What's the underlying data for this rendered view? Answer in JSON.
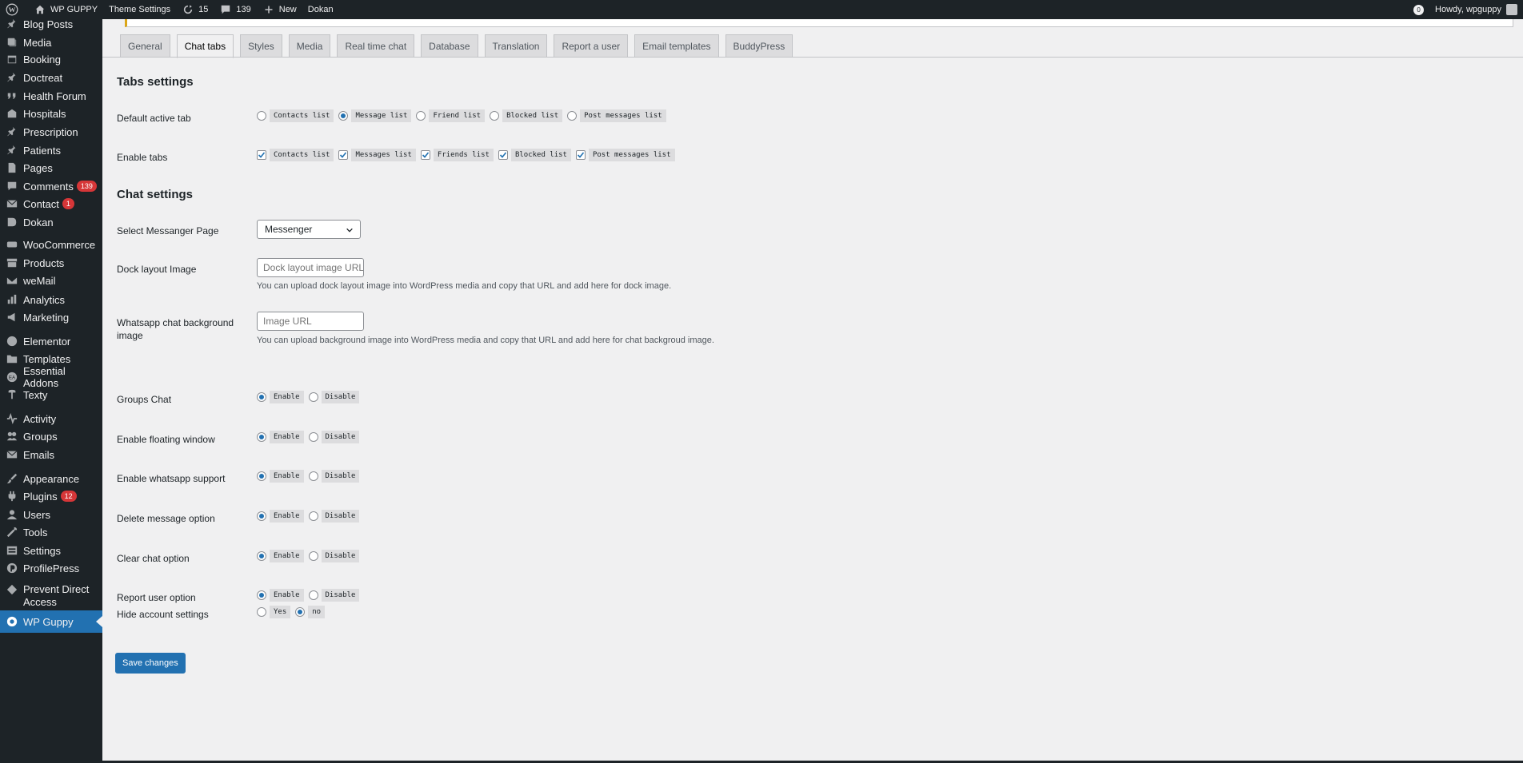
{
  "adminbar": {
    "site_name": "WP GUPPY",
    "theme_settings": "Theme Settings",
    "updates_count": "15",
    "comments_count": "139",
    "new_label": "New",
    "dokan_label": "Dokan",
    "howdy": "Howdy, wpguppy",
    "notif_count": "0"
  },
  "sidebar": {
    "items": [
      {
        "label": "Blog Posts",
        "icon": "pin-icon"
      },
      {
        "label": "Media",
        "icon": "media-icon"
      },
      {
        "label": "Booking",
        "icon": "calendar-icon"
      },
      {
        "label": "Doctreat",
        "icon": "pin-icon"
      },
      {
        "label": "Health Forum",
        "icon": "quote-icon"
      },
      {
        "label": "Hospitals",
        "icon": "building-icon"
      },
      {
        "label": "Prescription",
        "icon": "pin-icon"
      },
      {
        "label": "Patients",
        "icon": "pin-icon"
      },
      {
        "label": "Pages",
        "icon": "page-icon"
      },
      {
        "label": "Comments",
        "icon": "comment-icon",
        "badge": "139"
      },
      {
        "label": "Contact",
        "icon": "mail-icon",
        "badge": "1"
      },
      {
        "label": "Dokan",
        "icon": "dokan-icon"
      },
      {
        "label": "WooCommerce",
        "icon": "woo-icon"
      },
      {
        "label": "Products",
        "icon": "archive-icon"
      },
      {
        "label": "weMail",
        "icon": "wemail-icon"
      },
      {
        "label": "Analytics",
        "icon": "bar-chart-icon"
      },
      {
        "label": "Marketing",
        "icon": "megaphone-icon"
      },
      {
        "label": "Elementor",
        "icon": "elementor-icon"
      },
      {
        "label": "Templates",
        "icon": "folder-icon"
      },
      {
        "label": "Essential Addons",
        "icon": "ea-icon"
      },
      {
        "label": "Texty",
        "icon": "texty-icon"
      },
      {
        "label": "Activity",
        "icon": "activity-icon"
      },
      {
        "label": "Groups",
        "icon": "groups-icon"
      },
      {
        "label": "Emails",
        "icon": "mail-icon"
      },
      {
        "label": "Appearance",
        "icon": "brush-icon"
      },
      {
        "label": "Plugins",
        "icon": "plugin-icon",
        "badge": "12"
      },
      {
        "label": "Users",
        "icon": "users-icon"
      },
      {
        "label": "Tools",
        "icon": "wrench-icon"
      },
      {
        "label": "Settings",
        "icon": "settings-icon"
      },
      {
        "label": "ProfilePress",
        "icon": "profilepress-icon"
      },
      {
        "label": "Prevent Direct Access",
        "icon": "lock-icon"
      },
      {
        "label": "WP Guppy",
        "icon": "guppy-icon",
        "current": true
      }
    ]
  },
  "tabs": [
    "General",
    "Chat tabs",
    "Styles",
    "Media",
    "Real time chat",
    "Database",
    "Translation",
    "Report a user",
    "Email templates",
    "BuddyPress"
  ],
  "active_tab": "Chat tabs",
  "tabs_settings": {
    "title": "Tabs settings",
    "default_active_tab": {
      "label": "Default active tab",
      "options": [
        "Contacts list",
        "Message list",
        "Friend list",
        "Blocked list",
        "Post messages list"
      ],
      "selected": "Message list"
    },
    "enable_tabs": {
      "label": "Enable tabs",
      "options": [
        "Contacts list",
        "Messages list",
        "Friends list",
        "Blocked list",
        "Post messages list"
      ]
    }
  },
  "chat_settings": {
    "title": "Chat settings",
    "messenger_page": {
      "label": "Select Messanger Page",
      "value": "Messenger"
    },
    "dock_layout": {
      "label": "Dock layout Image",
      "placeholder": "Dock layout image URL",
      "desc": "You can upload dock layout image into WordPress media and copy that URL and add here for dock image."
    },
    "whatsapp_bg": {
      "label_line1": "Whatsapp chat background",
      "label_line2": "image",
      "placeholder": "Image URL",
      "desc": "You can upload background image into WordPress media and copy that URL and add here for chat backgroud image."
    },
    "toggles": [
      {
        "label": "Groups Chat",
        "on": "Enable",
        "off": "Disable"
      },
      {
        "label": "Enable floating window",
        "on": "Enable",
        "off": "Disable"
      },
      {
        "label": "Enable whatsapp support",
        "on": "Enable",
        "off": "Disable"
      },
      {
        "label": "Delete message option",
        "on": "Enable",
        "off": "Disable"
      },
      {
        "label": "Clear chat option",
        "on": "Enable",
        "off": "Disable"
      },
      {
        "label": "Report user option",
        "on": "Enable",
        "off": "Disable"
      }
    ],
    "hide_account": {
      "label": "Hide account settings",
      "yes": "Yes",
      "no": "no"
    }
  },
  "save_label": "Save changes",
  "colors": {
    "accent": "#2271b1",
    "admin_dark": "#1d2327",
    "badge": "#d63638"
  }
}
